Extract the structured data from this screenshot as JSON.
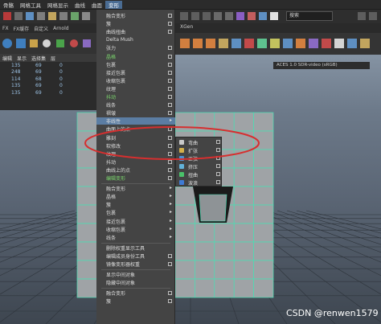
{
  "top_menu": [
    "骨骼",
    "网格工具",
    "网格显示",
    "曲线",
    "曲面",
    "变形"
  ],
  "shelf_tabs": [
    "FX",
    "FX缓存",
    "自定义",
    "Arnold"
  ],
  "xgen_label": "XGen",
  "panel_tabs": [
    "编辑",
    "显示",
    "选择集",
    "层"
  ],
  "search_value": "搜索",
  "aces_label": "ACES 1.0 SDR-video (sRGB)",
  "table_rows": [
    [
      "135",
      "69",
      "0"
    ],
    [
      "248",
      "69",
      "0"
    ],
    [
      "114",
      "68",
      "0"
    ],
    [
      "135",
      "69",
      "0"
    ],
    [
      "135",
      "69",
      "0"
    ]
  ],
  "menu_items": [
    {
      "label": "融合变形",
      "kind": "box"
    },
    {
      "label": "簇",
      "kind": "box"
    },
    {
      "label": "曲线扭曲",
      "kind": "box"
    },
    {
      "label": "Delta Mush",
      "kind": "none"
    },
    {
      "label": "张力",
      "kind": "box"
    },
    {
      "label": "晶格",
      "kind": "box",
      "green": true
    },
    {
      "label": "包裹",
      "kind": "box"
    },
    {
      "label": "接近包裹",
      "kind": "box"
    },
    {
      "label": "收缩包裹",
      "kind": "box"
    },
    {
      "label": "纹理",
      "kind": "box"
    },
    {
      "label": "抖动",
      "kind": "box",
      "green": true
    },
    {
      "label": "线条",
      "kind": "box"
    },
    {
      "label": "褶皱",
      "kind": "box"
    },
    {
      "label": "非线性",
      "kind": "arrow",
      "highlight": true
    },
    {
      "label": "曲面上的点",
      "kind": "box"
    },
    {
      "label": "雕刻",
      "kind": "box"
    },
    {
      "label": "软修改",
      "kind": "box"
    },
    {
      "label": "纹理",
      "kind": "box"
    },
    {
      "label": "抖动",
      "kind": "box"
    },
    {
      "label": "曲线上的点",
      "kind": "box"
    },
    {
      "label": "编辑变形",
      "kind": "box",
      "green": true
    },
    {
      "label": "融合变形",
      "kind": "arrow"
    },
    {
      "label": "晶格",
      "kind": "arrow"
    },
    {
      "label": "簇",
      "kind": "arrow"
    },
    {
      "label": "包裹",
      "kind": "arrow"
    },
    {
      "label": "接近包裹",
      "kind": "arrow"
    },
    {
      "label": "收缩包裹",
      "kind": "arrow"
    },
    {
      "label": "线条",
      "kind": "arrow"
    },
    {
      "label": "删除权重显示工具",
      "kind": "none"
    },
    {
      "label": "编辑成员身份工具",
      "kind": "box"
    },
    {
      "label": "镜像变形器权重",
      "kind": "box"
    },
    {
      "label": "显示中间对象",
      "kind": "none"
    },
    {
      "label": "隐藏中间对象",
      "kind": "none"
    },
    {
      "label": "融合变形",
      "kind": "box"
    },
    {
      "label": "簇",
      "kind": "box"
    }
  ],
  "submenu_items": [
    {
      "label": "弯曲",
      "color": "#c9c9c9"
    },
    {
      "label": "扩张",
      "color": "#d2b04a"
    },
    {
      "label": "正弦",
      "color": "#4a8fd2"
    },
    {
      "label": "挤压",
      "color": "#62b2d9"
    },
    {
      "label": "扭曲",
      "color": "#4ac26a"
    },
    {
      "label": "波浪",
      "color": "#3e7bd4"
    }
  ],
  "watermark": "CSDN @renwen1579",
  "colors": {
    "menu_bg": "#444444",
    "highlight": "#5b7da3",
    "annotation": "#d62f2f",
    "mesh_face": "#9fa3a6",
    "mesh_edge": "#46e0b4"
  }
}
